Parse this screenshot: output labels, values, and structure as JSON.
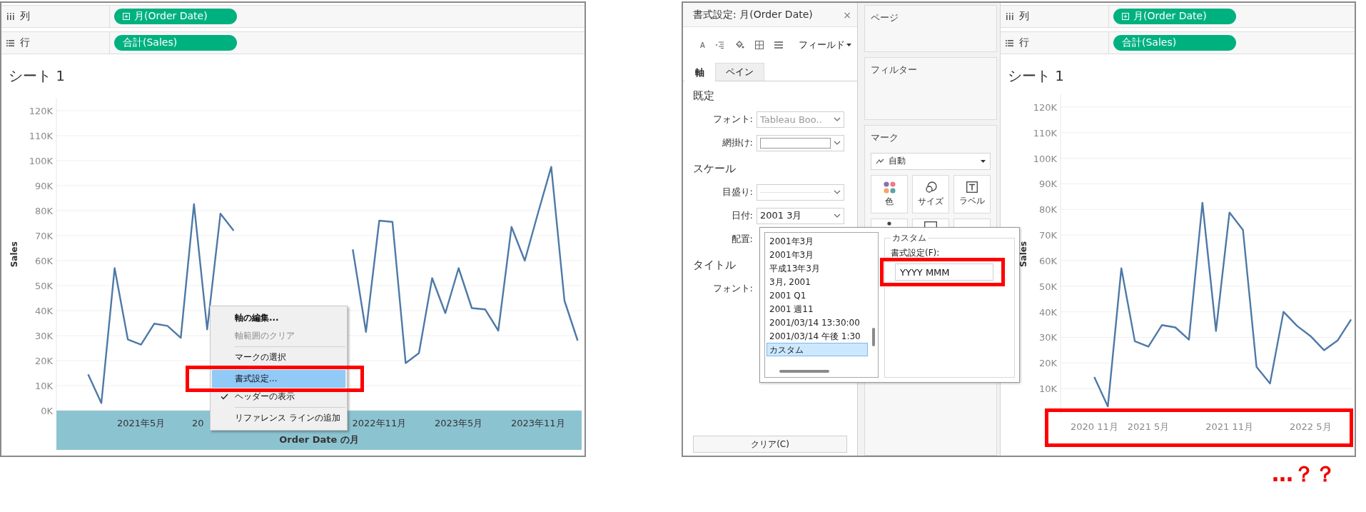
{
  "left_screen": {
    "shelves": [
      {
        "kind": "columns",
        "label": "列",
        "pill": "月(Order Date)",
        "pill_icon": true
      },
      {
        "kind": "rows",
        "label": "行",
        "pill": "合計(Sales)",
        "pill_icon": false
      }
    ],
    "sheet_title": "シート 1",
    "covered_axis_label": "20",
    "chart_data": {
      "type": "line",
      "xlabel": "Order Date の月",
      "ylabel": "Sales",
      "grid": true,
      "categories": [
        null,
        null,
        null,
        null,
        "2021年5月",
        null,
        null,
        null,
        null,
        null,
        null,
        null,
        null,
        null,
        null,
        null,
        null,
        null,
        null,
        null,
        null,
        null,
        "2022年11月",
        null,
        null,
        null,
        null,
        null,
        "2023年5月",
        null,
        null,
        null,
        null,
        null,
        "2023年11月",
        null,
        null,
        null
      ],
      "ylim": [
        0,
        125
      ],
      "yticks": [
        {
          "value": 0,
          "label": "0K"
        },
        {
          "value": 10,
          "label": "10K"
        },
        {
          "value": 20,
          "label": "20K"
        },
        {
          "value": 30,
          "label": "30K"
        },
        {
          "value": 40,
          "label": "40K"
        },
        {
          "value": 50,
          "label": "50K"
        },
        {
          "value": 60,
          "label": "60K"
        },
        {
          "value": 70,
          "label": "70K"
        },
        {
          "value": 80,
          "label": "80K"
        },
        {
          "value": 90,
          "label": "90K"
        },
        {
          "value": 100,
          "label": "100K"
        },
        {
          "value": 110,
          "label": "110K"
        },
        {
          "value": 120,
          "label": "120K"
        }
      ],
      "series": [
        {
          "color": "#4e79a7",
          "values": [
            14.5,
            3,
            57,
            28.5,
            26.4,
            34.8,
            33.9,
            29.1,
            82.6,
            32.5,
            78.8,
            72,
            null,
            null,
            null,
            null,
            null,
            null,
            null,
            null,
            64.5,
            31.5,
            76,
            75.5,
            19,
            23,
            53,
            39,
            57,
            41,
            40.5,
            32,
            73.5,
            60,
            79,
            97.5,
            44,
            28
          ]
        }
      ]
    },
    "context_menu": {
      "items": [
        {
          "kind": "item",
          "label": "軸の編集...",
          "bold": true,
          "disabled": false,
          "selected": false,
          "checked": false
        },
        {
          "kind": "item",
          "label": "軸範囲のクリア",
          "bold": false,
          "disabled": true,
          "selected": false,
          "checked": false
        },
        {
          "kind": "separator"
        },
        {
          "kind": "item",
          "label": "マークの選択",
          "bold": false,
          "disabled": false,
          "selected": false,
          "checked": false
        },
        {
          "kind": "separator"
        },
        {
          "kind": "item",
          "label": "書式設定...",
          "bold": false,
          "disabled": false,
          "selected": true,
          "checked": false
        },
        {
          "kind": "item",
          "label": "ヘッダーの表示",
          "bold": false,
          "disabled": false,
          "selected": false,
          "checked": true
        },
        {
          "kind": "separator"
        },
        {
          "kind": "item",
          "label": "リファレンス ラインの追加",
          "bold": false,
          "disabled": false,
          "selected": false,
          "checked": false
        }
      ]
    }
  },
  "right_screen": {
    "format_pane": {
      "title": "書式設定: 月(Order Date)",
      "close": "×",
      "toolbar": [
        {
          "kind": "font",
          "glyph": "A"
        },
        {
          "kind": "alignment"
        },
        {
          "kind": "shading"
        },
        {
          "kind": "borders"
        },
        {
          "kind": "lines"
        }
      ],
      "field_menu": "フィールド",
      "tabs": [
        {
          "label": "軸",
          "selected": true
        },
        {
          "label": "ペイン",
          "selected": false
        }
      ],
      "sections": [
        {
          "title": "既定",
          "rows": [
            {
              "label": "フォント:",
              "kind": "font",
              "value": "Tableau Boo.."
            },
            {
              "label": "網掛け:",
              "kind": "shading"
            }
          ]
        },
        {
          "title": "スケール",
          "rows": [
            {
              "label": "目盛り:",
              "kind": "line"
            },
            {
              "label": "日付:",
              "kind": "dropdown",
              "value": "2001 3月"
            },
            {
              "label": "配置:",
              "kind": "covered"
            }
          ]
        },
        {
          "title": "タイトル",
          "rows": [
            {
              "label": "フォント:",
              "kind": "covered"
            }
          ]
        }
      ],
      "clear_button": "クリア(C)"
    },
    "cards": {
      "pages": "ページ",
      "filters": "フィルター",
      "marks": {
        "title": "マーク",
        "mark_type": "自動",
        "buttons": [
          {
            "kind": "color",
            "label": "色"
          },
          {
            "kind": "size",
            "label": "サイズ"
          },
          {
            "kind": "label",
            "label": "ラベル"
          },
          {
            "kind": "detail"
          },
          {
            "kind": "tooltip"
          },
          {
            "kind": "path"
          }
        ]
      }
    },
    "date_popup": {
      "formats": [
        {
          "label": "2001年3月",
          "selected": false
        },
        {
          "label": "2001年3月",
          "selected": false
        },
        {
          "label": "平成13年3月",
          "selected": false
        },
        {
          "label": "3月, 2001",
          "selected": false
        },
        {
          "label": "2001 Q1",
          "selected": false
        },
        {
          "label": "2001 週11",
          "selected": false
        },
        {
          "label": "2001/03/14 13:30:00",
          "selected": false
        },
        {
          "label": "2001/03/14 午後 1:30",
          "selected": false
        },
        {
          "label": "カスタム",
          "selected": true
        }
      ],
      "custom_group": "カスタム",
      "format_label": "書式設定(F):",
      "format_value": "YYYY MMM"
    },
    "shelves": [
      {
        "kind": "columns",
        "label": "列",
        "pill": "月(Order Date)",
        "pill_icon": true
      },
      {
        "kind": "rows",
        "label": "行",
        "pill": "合計(Sales)",
        "pill_icon": false
      }
    ],
    "sheet_title": "シート 1",
    "chart_data": {
      "type": "line",
      "ylabel": "Sales",
      "grid": true,
      "categories": [
        "2020 11月",
        null,
        null,
        null,
        "2021 5月",
        null,
        null,
        null,
        null,
        null,
        "2021 11月",
        null,
        null,
        null,
        null,
        null,
        "2022 5月",
        null,
        null,
        null
      ],
      "ylim": [
        0,
        125
      ],
      "yticks": [
        {
          "value": 10,
          "label": "10K"
        },
        {
          "value": 20,
          "label": "20K"
        },
        {
          "value": 30,
          "label": "30K"
        },
        {
          "value": 40,
          "label": "40K"
        },
        {
          "value": 50,
          "label": "50K"
        },
        {
          "value": 60,
          "label": "60K"
        },
        {
          "value": 70,
          "label": "70K"
        },
        {
          "value": 80,
          "label": "80K"
        },
        {
          "value": 90,
          "label": "90K"
        },
        {
          "value": 100,
          "label": "100K"
        },
        {
          "value": 110,
          "label": "110K"
        },
        {
          "value": 120,
          "label": "120K"
        }
      ],
      "series": [
        {
          "color": "#4e79a7",
          "values": [
            14.5,
            3,
            57,
            28.5,
            26.4,
            34.8,
            33.9,
            29.1,
            82.6,
            32.5,
            78.8,
            72,
            18.5,
            12,
            40,
            34.5,
            30.5,
            25,
            28.8,
            37
          ]
        }
      ]
    }
  },
  "caption": "…？？"
}
